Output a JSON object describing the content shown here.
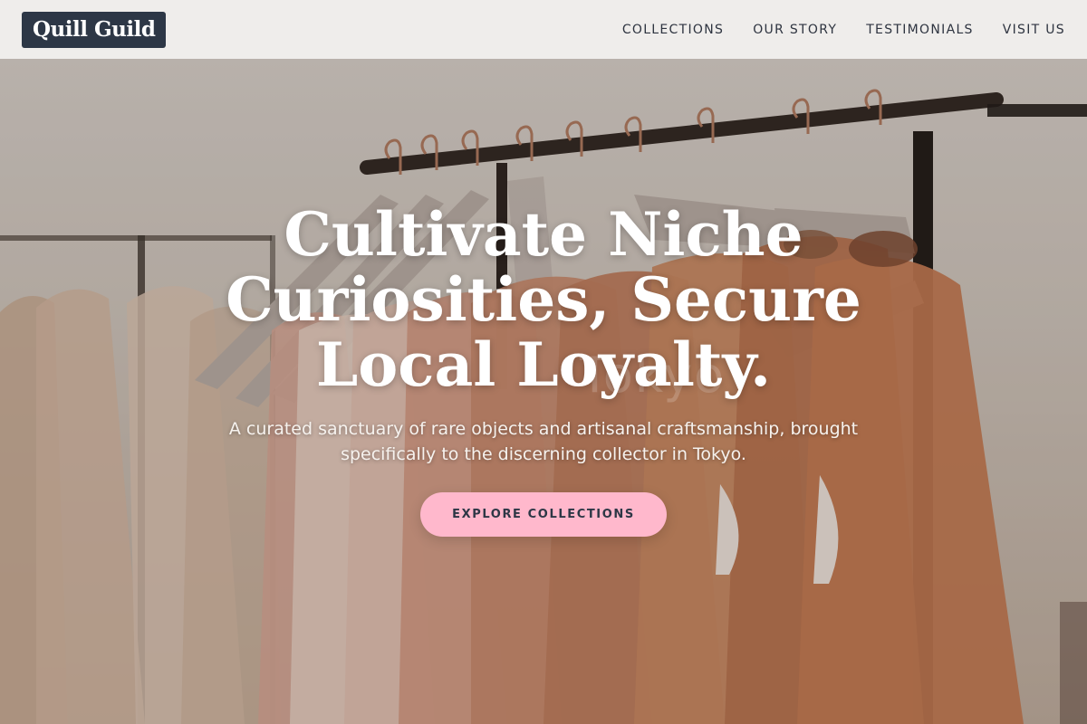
{
  "header": {
    "logo": "Quill Guild",
    "nav": [
      {
        "label": "COLLECTIONS"
      },
      {
        "label": "OUR STORY"
      },
      {
        "label": "TESTIMONIALS"
      },
      {
        "label": "VISIT US"
      }
    ]
  },
  "hero": {
    "headline": "Cultivate Niche Curiosities, Secure Local Loyalty.",
    "subtitle": "A curated sanctuary of rare objects and artisanal craftsmanship, brought specifically to the discerning collector in Tokyo.",
    "cta_label": "EXPLORE COLLECTIONS",
    "watermark": "Tokyo"
  },
  "colors": {
    "logo_bg": "#2d3746",
    "cta_bg": "#ffb8cc",
    "header_bg": "#efedeb"
  }
}
